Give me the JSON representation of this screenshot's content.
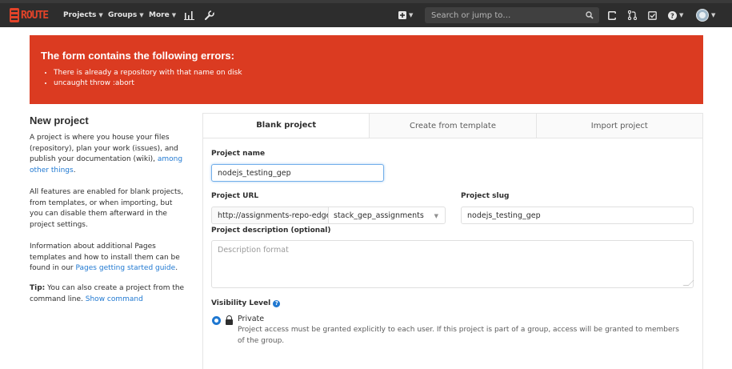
{
  "navbar": {
    "logo_text": "ROUTE",
    "projects": "Projects",
    "groups": "Groups",
    "more": "More",
    "search_placeholder": "Search or jump to…",
    "icons": [
      "activity-chart-icon",
      "wrench-icon",
      "plus-square-icon",
      "search-icon",
      "todo-list-icon",
      "merge-request-icon",
      "issues-check-icon",
      "help-icon",
      "avatar"
    ]
  },
  "error": {
    "title": "The form contains the following errors:",
    "items": [
      "There is already a repository with that name on disk",
      "uncaught throw :abort"
    ]
  },
  "sidebar": {
    "title": "New project",
    "p1_text": "A project is where you house your files (repository), plan your work (issues), and publish your documentation (wiki),",
    "p1_link": "among other things",
    "p1_end": ".",
    "p2": "All features are enabled for blank projects, from templates, or when importing, but you can disable them afterward in the project settings.",
    "p3_text": "Information about additional Pages templates and how to install them can be found in our",
    "p3_link": "Pages getting started guide",
    "p3_end": ".",
    "tip_label": "Tip:",
    "tip_text": "You can also create a project from the command line.",
    "tip_link": "Show command"
  },
  "tabs": [
    {
      "label": "Blank project",
      "active": true
    },
    {
      "label": "Create from template",
      "active": false
    },
    {
      "label": "Import project",
      "active": false
    }
  ],
  "form": {
    "project_name_label": "Project name",
    "project_name_value": "nodejs_testing_gep",
    "project_url_label": "Project URL",
    "project_url_prefix": "http://assignments-repo-edge.st",
    "project_url_namespace": "stack_gep_assignments",
    "project_slug_label": "Project slug",
    "project_slug_value": "nodejs_testing_gep",
    "description_label": "Project description (optional)",
    "description_placeholder": "Description format",
    "visibility_label": "Visibility Level",
    "visibility_private_label": "Private",
    "visibility_private_desc": "Project access must be granted explicitly to each user. If this project is part of a group, access will be granted to members of the group."
  },
  "colors": {
    "error_bg": "#db3b21",
    "navbar_bg": "#2d2d2d",
    "link": "#1f78d1",
    "brand": "#e24329"
  }
}
